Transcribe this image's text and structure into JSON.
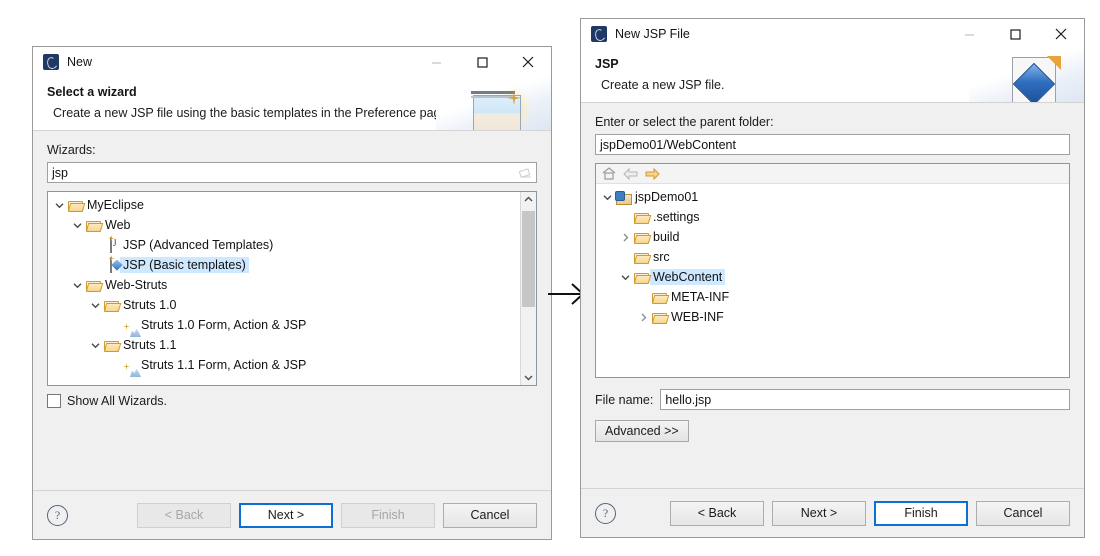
{
  "left_dialog": {
    "title": "New",
    "title_icon": "myeclipse-icon",
    "window_buttons": {
      "minimize": "minimize-icon",
      "maximize": "maximize-icon",
      "close": "close-icon"
    },
    "banner": {
      "heading": "Select a wizard",
      "subtext": "Create a new JSP file using the basic templates in the Preference pages",
      "art": "wizard-banner-icon"
    },
    "wizards_label": "Wizards:",
    "filter": {
      "value": "jsp",
      "placeholder": "",
      "clear_icon": "eraser-icon"
    },
    "tree": [
      {
        "label": "MyEclipse",
        "indent": 0,
        "twisty": "expanded",
        "icon": "folder-icon",
        "selected": false
      },
      {
        "label": "Web",
        "indent": 1,
        "twisty": "expanded",
        "icon": "folder-icon",
        "selected": false
      },
      {
        "label": "JSP (Advanced Templates)",
        "indent": 2,
        "twisty": "none",
        "icon": "jsp-advanced-icon",
        "selected": false
      },
      {
        "label": "JSP (Basic templates)",
        "indent": 2,
        "twisty": "none",
        "icon": "jsp-basic-icon",
        "selected": true
      },
      {
        "label": "Web-Struts",
        "indent": 1,
        "twisty": "expanded",
        "icon": "folder-icon",
        "selected": false
      },
      {
        "label": "Struts 1.0",
        "indent": 2,
        "twisty": "expanded",
        "icon": "folder-icon",
        "selected": false
      },
      {
        "label": "Struts 1.0 Form, Action & JSP",
        "indent": 3,
        "twisty": "none",
        "icon": "struts-icon",
        "selected": false
      },
      {
        "label": "Struts 1.1",
        "indent": 2,
        "twisty": "expanded",
        "icon": "folder-icon",
        "selected": false
      },
      {
        "label": "Struts 1.1 Form, Action & JSP",
        "indent": 3,
        "twisty": "none",
        "icon": "struts-icon",
        "selected": false
      }
    ],
    "scrollbar": {
      "up": "scroll-up-icon",
      "down": "scroll-down-icon"
    },
    "show_all_wizards": {
      "label": "Show All Wizards.",
      "checked": false
    },
    "footer": {
      "help": "help-icon",
      "buttons": [
        {
          "label": "< Back",
          "enabled": false,
          "default": false
        },
        {
          "label": "Next >",
          "enabled": true,
          "default": true
        },
        {
          "label": "Finish",
          "enabled": false,
          "default": false
        },
        {
          "label": "Cancel",
          "enabled": true,
          "default": false
        }
      ]
    }
  },
  "right_dialog": {
    "title": "New JSP File",
    "title_icon": "myeclipse-icon",
    "window_buttons": {
      "minimize": "minimize-icon",
      "maximize": "maximize-icon",
      "close": "close-icon"
    },
    "banner": {
      "heading": "JSP",
      "subtext": "Create a new JSP file.",
      "art": "jsp-file-banner-icon"
    },
    "parent_folder_label": "Enter or select the parent folder:",
    "parent_folder_value": "jspDemo01/WebContent",
    "tree_toolbar": [
      {
        "icon": "home-icon",
        "enabled": false
      },
      {
        "icon": "back-arrow-icon",
        "enabled": false
      },
      {
        "icon": "forward-arrow-icon",
        "enabled": true
      }
    ],
    "tree": [
      {
        "label": "jspDemo01",
        "indent": 0,
        "twisty": "expanded",
        "icon": "project-icon",
        "selected": false
      },
      {
        "label": ".settings",
        "indent": 1,
        "twisty": "none",
        "icon": "folder-icon",
        "selected": false
      },
      {
        "label": "build",
        "indent": 1,
        "twisty": "collapsed",
        "icon": "folder-icon",
        "selected": false
      },
      {
        "label": "src",
        "indent": 1,
        "twisty": "none",
        "icon": "folder-icon",
        "selected": false
      },
      {
        "label": "WebContent",
        "indent": 1,
        "twisty": "expanded",
        "icon": "folder-icon",
        "selected": true
      },
      {
        "label": "META-INF",
        "indent": 2,
        "twisty": "none",
        "icon": "folder-icon",
        "selected": false
      },
      {
        "label": "WEB-INF",
        "indent": 2,
        "twisty": "collapsed",
        "icon": "folder-icon",
        "selected": false
      }
    ],
    "file_name_label": "File name:",
    "file_name_value": "hello.jsp",
    "advanced_button": "Advanced >>",
    "footer": {
      "help": "help-icon",
      "buttons": [
        {
          "label": "< Back",
          "enabled": true,
          "default": false
        },
        {
          "label": "Next >",
          "enabled": true,
          "default": false
        },
        {
          "label": "Finish",
          "enabled": true,
          "default": true
        },
        {
          "label": "Cancel",
          "enabled": true,
          "default": false
        }
      ]
    }
  },
  "flow_arrow": "right-arrow-icon"
}
